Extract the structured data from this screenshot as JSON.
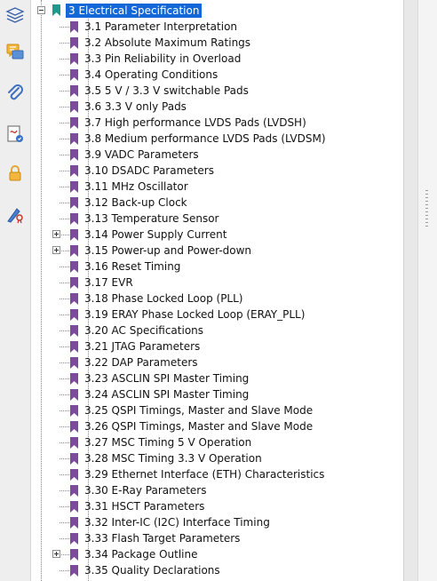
{
  "toolbar": {
    "tools": [
      {
        "icon": "layers-icon"
      },
      {
        "icon": "comments-icon"
      },
      {
        "icon": "paperclip-icon"
      },
      {
        "icon": "signature-icon"
      },
      {
        "icon": "lock-icon"
      },
      {
        "icon": "pen-ribbon-icon"
      }
    ]
  },
  "tree": {
    "root": {
      "label": "3 Electrical Specification",
      "expanded": true,
      "selected": true
    },
    "items": [
      {
        "label": "3.1 Parameter Interpretation",
        "expandable": false
      },
      {
        "label": "3.2 Absolute Maximum Ratings",
        "expandable": false
      },
      {
        "label": "3.3 Pin Reliability in Overload",
        "expandable": false
      },
      {
        "label": "3.4 Operating Conditions",
        "expandable": false
      },
      {
        "label": "3.5 5 V / 3.3 V switchable Pads",
        "expandable": false
      },
      {
        "label": "3.6 3.3 V only Pads",
        "expandable": false
      },
      {
        "label": "3.7 High performance LVDS Pads (LVDSH)",
        "expandable": false
      },
      {
        "label": "3.8 Medium performance LVDS Pads (LVDSM)",
        "expandable": false
      },
      {
        "label": "3.9 VADC Parameters",
        "expandable": false
      },
      {
        "label": "3.10 DSADC Parameters",
        "expandable": false
      },
      {
        "label": "3.11 MHz Oscillator",
        "expandable": false
      },
      {
        "label": "3.12 Back-up Clock",
        "expandable": false
      },
      {
        "label": "3.13 Temperature Sensor",
        "expandable": false
      },
      {
        "label": "3.14 Power Supply Current",
        "expandable": true
      },
      {
        "label": "3.15 Power-up and Power-down",
        "expandable": true
      },
      {
        "label": "3.16 Reset Timing",
        "expandable": false
      },
      {
        "label": "3.17 EVR",
        "expandable": false
      },
      {
        "label": "3.18 Phase Locked Loop (PLL)",
        "expandable": false
      },
      {
        "label": "3.19 ERAY Phase Locked Loop (ERAY_PLL)",
        "expandable": false
      },
      {
        "label": "3.20 AC Specifications",
        "expandable": false
      },
      {
        "label": "3.21 JTAG Parameters",
        "expandable": false
      },
      {
        "label": "3.22 DAP Parameters",
        "expandable": false
      },
      {
        "label": "3.23 ASCLIN SPI Master Timing",
        "expandable": false
      },
      {
        "label": "3.24 ASCLIN SPI Master Timing",
        "expandable": false
      },
      {
        "label": "3.25 QSPI Timings, Master and Slave Mode",
        "expandable": false
      },
      {
        "label": "3.26 QSPI Timings, Master and Slave Mode",
        "expandable": false
      },
      {
        "label": "3.27 MSC Timing 5 V Operation",
        "expandable": false
      },
      {
        "label": "3.28 MSC Timing 3.3 V Operation",
        "expandable": false
      },
      {
        "label": "3.29 Ethernet Interface (ETH) Characteristics",
        "expandable": false
      },
      {
        "label": "3.30 E-Ray Parameters",
        "expandable": false
      },
      {
        "label": "3.31 HSCT Parameters",
        "expandable": false
      },
      {
        "label": "3.32 Inter-IC (I2C) Interface Timing",
        "expandable": false
      },
      {
        "label": "3.33 Flash Target Parameters",
        "expandable": false
      },
      {
        "label": "3.34 Package Outline",
        "expandable": true
      },
      {
        "label": "3.35 Quality Declarations",
        "expandable": false
      }
    ]
  },
  "colors": {
    "bookmark": "#7d4b9c",
    "root_bookmark": "#1e9a8c",
    "selection": "#1467d6"
  }
}
